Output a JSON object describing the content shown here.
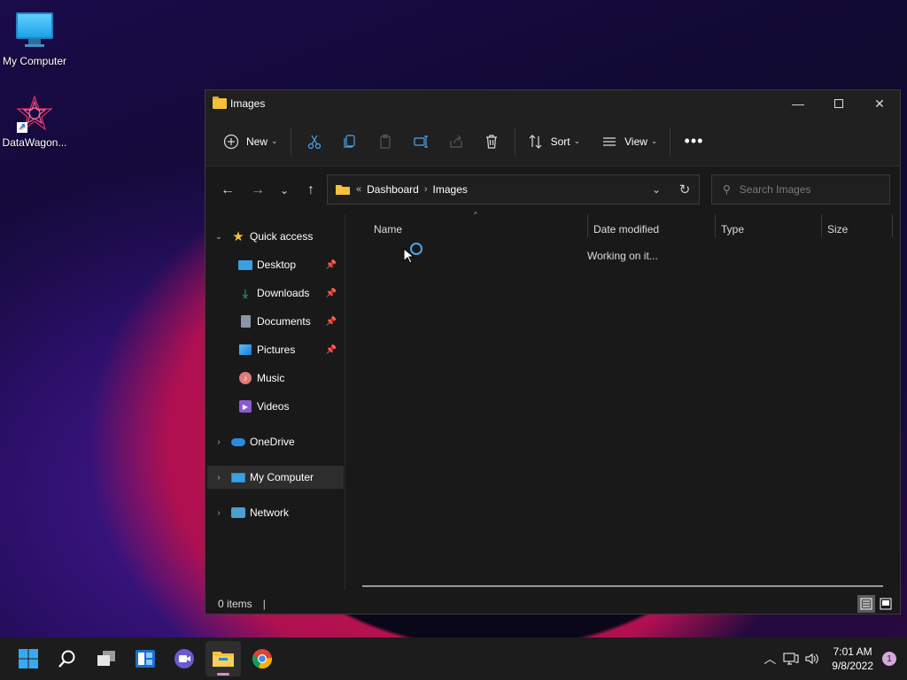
{
  "desktop": {
    "icons": [
      {
        "label": "My Computer"
      },
      {
        "label": "DataWagon..."
      }
    ]
  },
  "window": {
    "title": "Images",
    "toolbar": {
      "new_label": "New",
      "sort_label": "Sort",
      "view_label": "View"
    },
    "address": {
      "prefix": "«",
      "crumbs": [
        "Dashboard",
        "Images"
      ]
    },
    "search": {
      "placeholder": "Search Images"
    },
    "sidebar": {
      "quick_access": "Quick access",
      "items": [
        {
          "label": "Desktop"
        },
        {
          "label": "Downloads"
        },
        {
          "label": "Documents"
        },
        {
          "label": "Pictures"
        },
        {
          "label": "Music"
        },
        {
          "label": "Videos"
        }
      ],
      "onedrive": "OneDrive",
      "my_computer": "My Computer",
      "network": "Network"
    },
    "columns": {
      "name": "Name",
      "date_modified": "Date modified",
      "type": "Type",
      "size": "Size"
    },
    "working_text": "Working on it...",
    "status": {
      "items": "0 items"
    }
  },
  "taskbar": {
    "time": "7:01 AM",
    "date": "9/8/2022",
    "notification_count": "1"
  },
  "colors": {
    "accent": "#4fa3e8",
    "folder": "#f3c13a",
    "window_bg": "#191919",
    "chrome_bg": "#202020"
  }
}
